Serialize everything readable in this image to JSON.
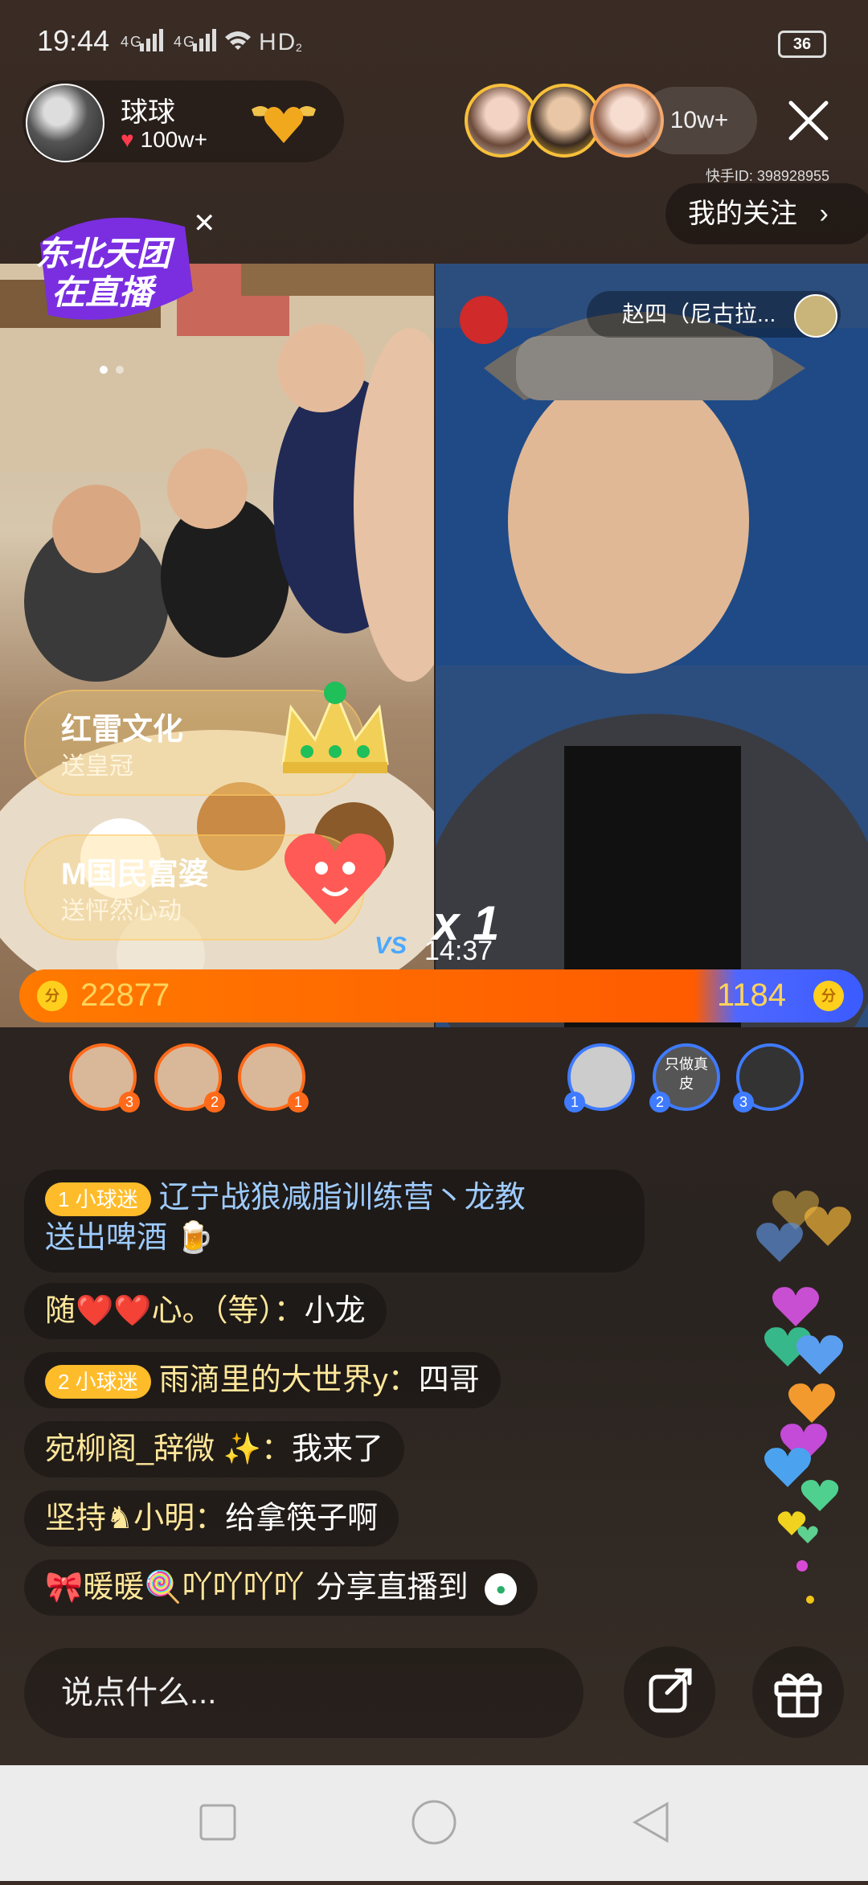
{
  "status_bar": {
    "time": "19:44",
    "signal_text": "4G 4G",
    "network_text": "HD",
    "battery": "36"
  },
  "host": {
    "name": "球球",
    "likes": "100w+"
  },
  "viewers": {
    "count": "10w+"
  },
  "kuaishou_id": "快手ID: 398928955",
  "follow_button": "我的关注",
  "promo": {
    "line1": "东北天团",
    "line2": "在直播"
  },
  "guest": {
    "name": "赵四（尼古拉..."
  },
  "gifts": [
    {
      "sender": "红雷文化",
      "action": "送皇冠"
    },
    {
      "sender": "M国民富婆",
      "action": "送怦然心动"
    }
  ],
  "pk": {
    "multiplier": "x 1",
    "timer": "14:37",
    "left_score": "22877",
    "right_score": "1184",
    "coin_label": "分"
  },
  "contributors_left": [
    "3",
    "2",
    "1"
  ],
  "contributors_right": [
    "1",
    "2",
    "3"
  ],
  "contrib_tag": "只做真皮",
  "chat": [
    {
      "badge": "1  小球迷",
      "user": "辽宁战狼减脂训练营丶龙教",
      "text": "送出啤酒 🍺"
    },
    {
      "user": "随❤️❤️心。（等）：",
      "text": "小龙"
    },
    {
      "badge": "2  小球迷",
      "user": "雨滴里的大世界y：",
      "text": "四哥"
    },
    {
      "user": "宛柳阁_辞微 ✨：",
      "text": "我来了"
    },
    {
      "user": "坚持♞小明：",
      "text": "给拿筷子啊"
    },
    {
      "user": "🎀暖暖🍭吖吖吖吖",
      "text": "分享直播到"
    }
  ],
  "input": {
    "placeholder": "说点什么..."
  },
  "colors": {
    "accent_orange": "#ff6a00",
    "accent_blue": "#3f7bff",
    "gold": "#ffbc2a"
  }
}
